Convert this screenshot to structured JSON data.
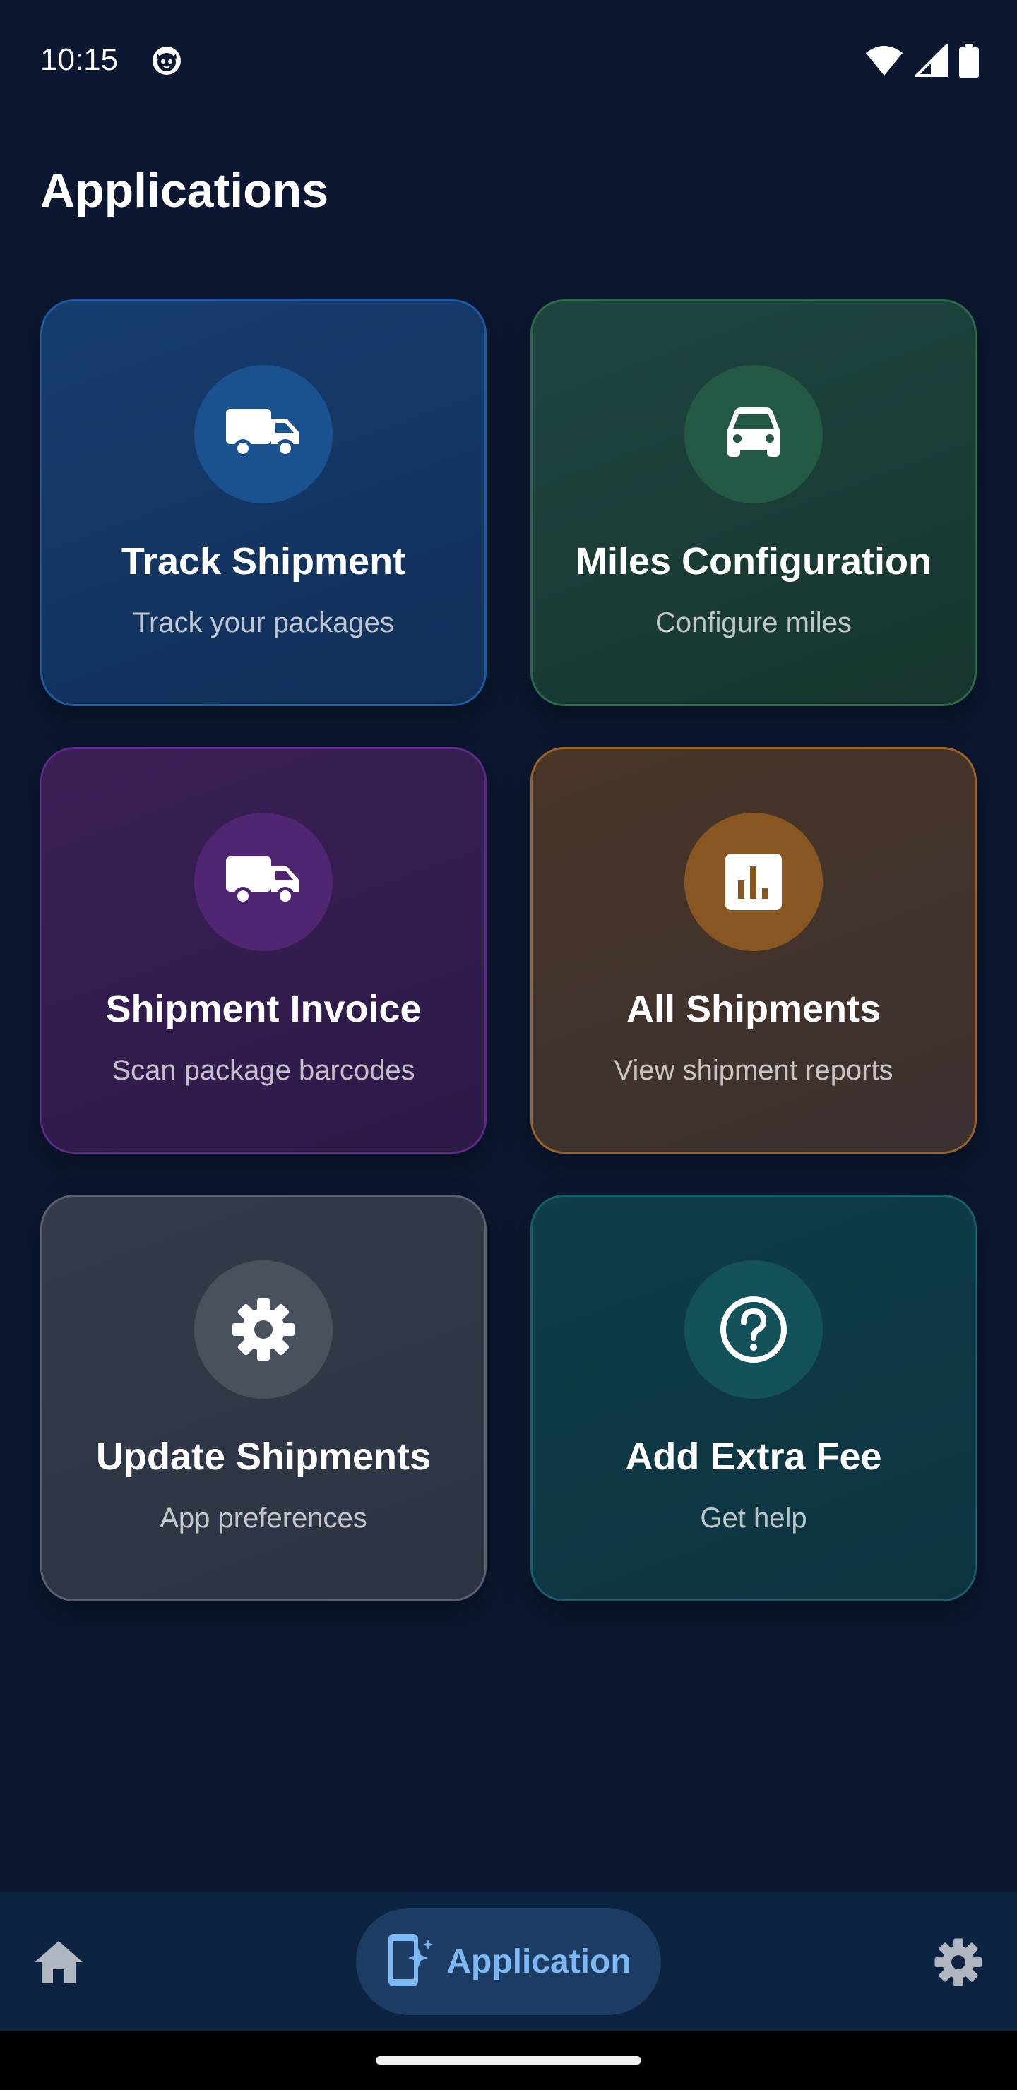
{
  "status_bar": {
    "time": "10:15",
    "app_icon": "cat-face-icon",
    "wifi_icon": "wifi-icon",
    "signal_icon": "cell-signal-icon",
    "battery_icon": "battery-icon"
  },
  "page": {
    "title": "Applications"
  },
  "tiles": [
    {
      "title": "Track Shipment",
      "subtitle": "Track your packages",
      "icon": "truck-icon",
      "accent": "#1d5aa0"
    },
    {
      "title": "Miles Configuration",
      "subtitle": "Configure miles",
      "icon": "car-icon",
      "accent": "#2a6a46"
    },
    {
      "title": "Shipment Invoice",
      "subtitle": "Scan package barcodes",
      "icon": "truck-icon",
      "accent": "#5a2a86"
    },
    {
      "title": "All Shipments",
      "subtitle": "View shipment reports",
      "icon": "bar-chart-icon",
      "accent": "#9a6224"
    },
    {
      "title": "Update Shipments",
      "subtitle": "App preferences",
      "icon": "gear-icon",
      "accent": "#59606e"
    },
    {
      "title": "Add Extra Fee",
      "subtitle": "Get help",
      "icon": "help-circle-icon",
      "accent": "#17606a"
    }
  ],
  "bottom_nav": {
    "home_icon": "home-icon",
    "active_label": "Application",
    "active_icon": "app-spark-icon",
    "settings_icon": "gear-icon",
    "active_color": "#7db8f2",
    "inactive_color": "#b0b6c0"
  }
}
